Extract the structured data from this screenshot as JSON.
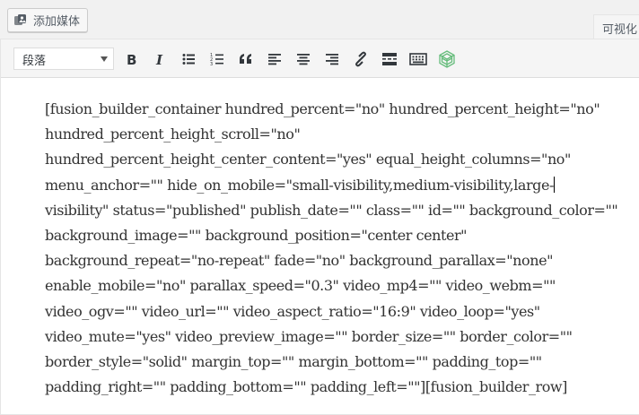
{
  "toolbar_top": {
    "add_media_label": "添加媒体",
    "visual_tab_label": "可视化"
  },
  "format_select": {
    "selected": "段落"
  },
  "toolbar_buttons": [
    {
      "name": "bold-button",
      "icon": "bold-icon"
    },
    {
      "name": "italic-button",
      "icon": "italic-icon"
    },
    {
      "name": "bullet-list-button",
      "icon": "bullet-list-icon"
    },
    {
      "name": "numbered-list-button",
      "icon": "numbered-list-icon"
    },
    {
      "name": "blockquote-button",
      "icon": "blockquote-icon"
    },
    {
      "name": "align-left-button",
      "icon": "align-left-icon"
    },
    {
      "name": "align-center-button",
      "icon": "align-center-icon"
    },
    {
      "name": "align-right-button",
      "icon": "align-right-icon"
    },
    {
      "name": "insert-link-button",
      "icon": "link-icon"
    },
    {
      "name": "read-more-button",
      "icon": "read-more-icon"
    },
    {
      "name": "toolbar-toggle-button",
      "icon": "keyboard-icon"
    },
    {
      "name": "fusion-builder-button",
      "icon": "fusion-logo-icon"
    }
  ],
  "editor_content": {
    "lines": [
      "[fusion_builder_container hundred_percent=\"no\" hundred_percent_height=\"no\"",
      "hundred_percent_height_scroll=\"no\"",
      "hundred_percent_height_center_content=\"yes\" equal_height_columns=\"no\"",
      "menu_anchor=\"\" hide_on_mobile=\"small-visibility,medium-visibility,large-",
      "visibility\" status=\"published\" publish_date=\"\" class=\"\" id=\"\" background_color=\"\"",
      "background_image=\"\" background_position=\"center center\"",
      "background_repeat=\"no-repeat\" fade=\"no\" background_parallax=\"none\"",
      "enable_mobile=\"no\" parallax_speed=\"0.3\" video_mp4=\"\" video_webm=\"\"",
      "video_ogv=\"\" video_url=\"\" video_aspect_ratio=\"16:9\" video_loop=\"yes\"",
      "video_mute=\"yes\" video_preview_image=\"\" border_size=\"\" border_color=\"\"",
      "border_style=\"solid\" margin_top=\"\" margin_bottom=\"\" padding_top=\"\"",
      "padding_right=\"\" padding_bottom=\"\" padding_left=\"\"][fusion_builder_row]"
    ]
  },
  "colors": {
    "background": "#f1f1f1",
    "toolbar": "#f5f5f5",
    "editor": "#ffffff",
    "text": "#333333",
    "icon": "#32373c",
    "fusion_accent": "#65bc7b"
  }
}
